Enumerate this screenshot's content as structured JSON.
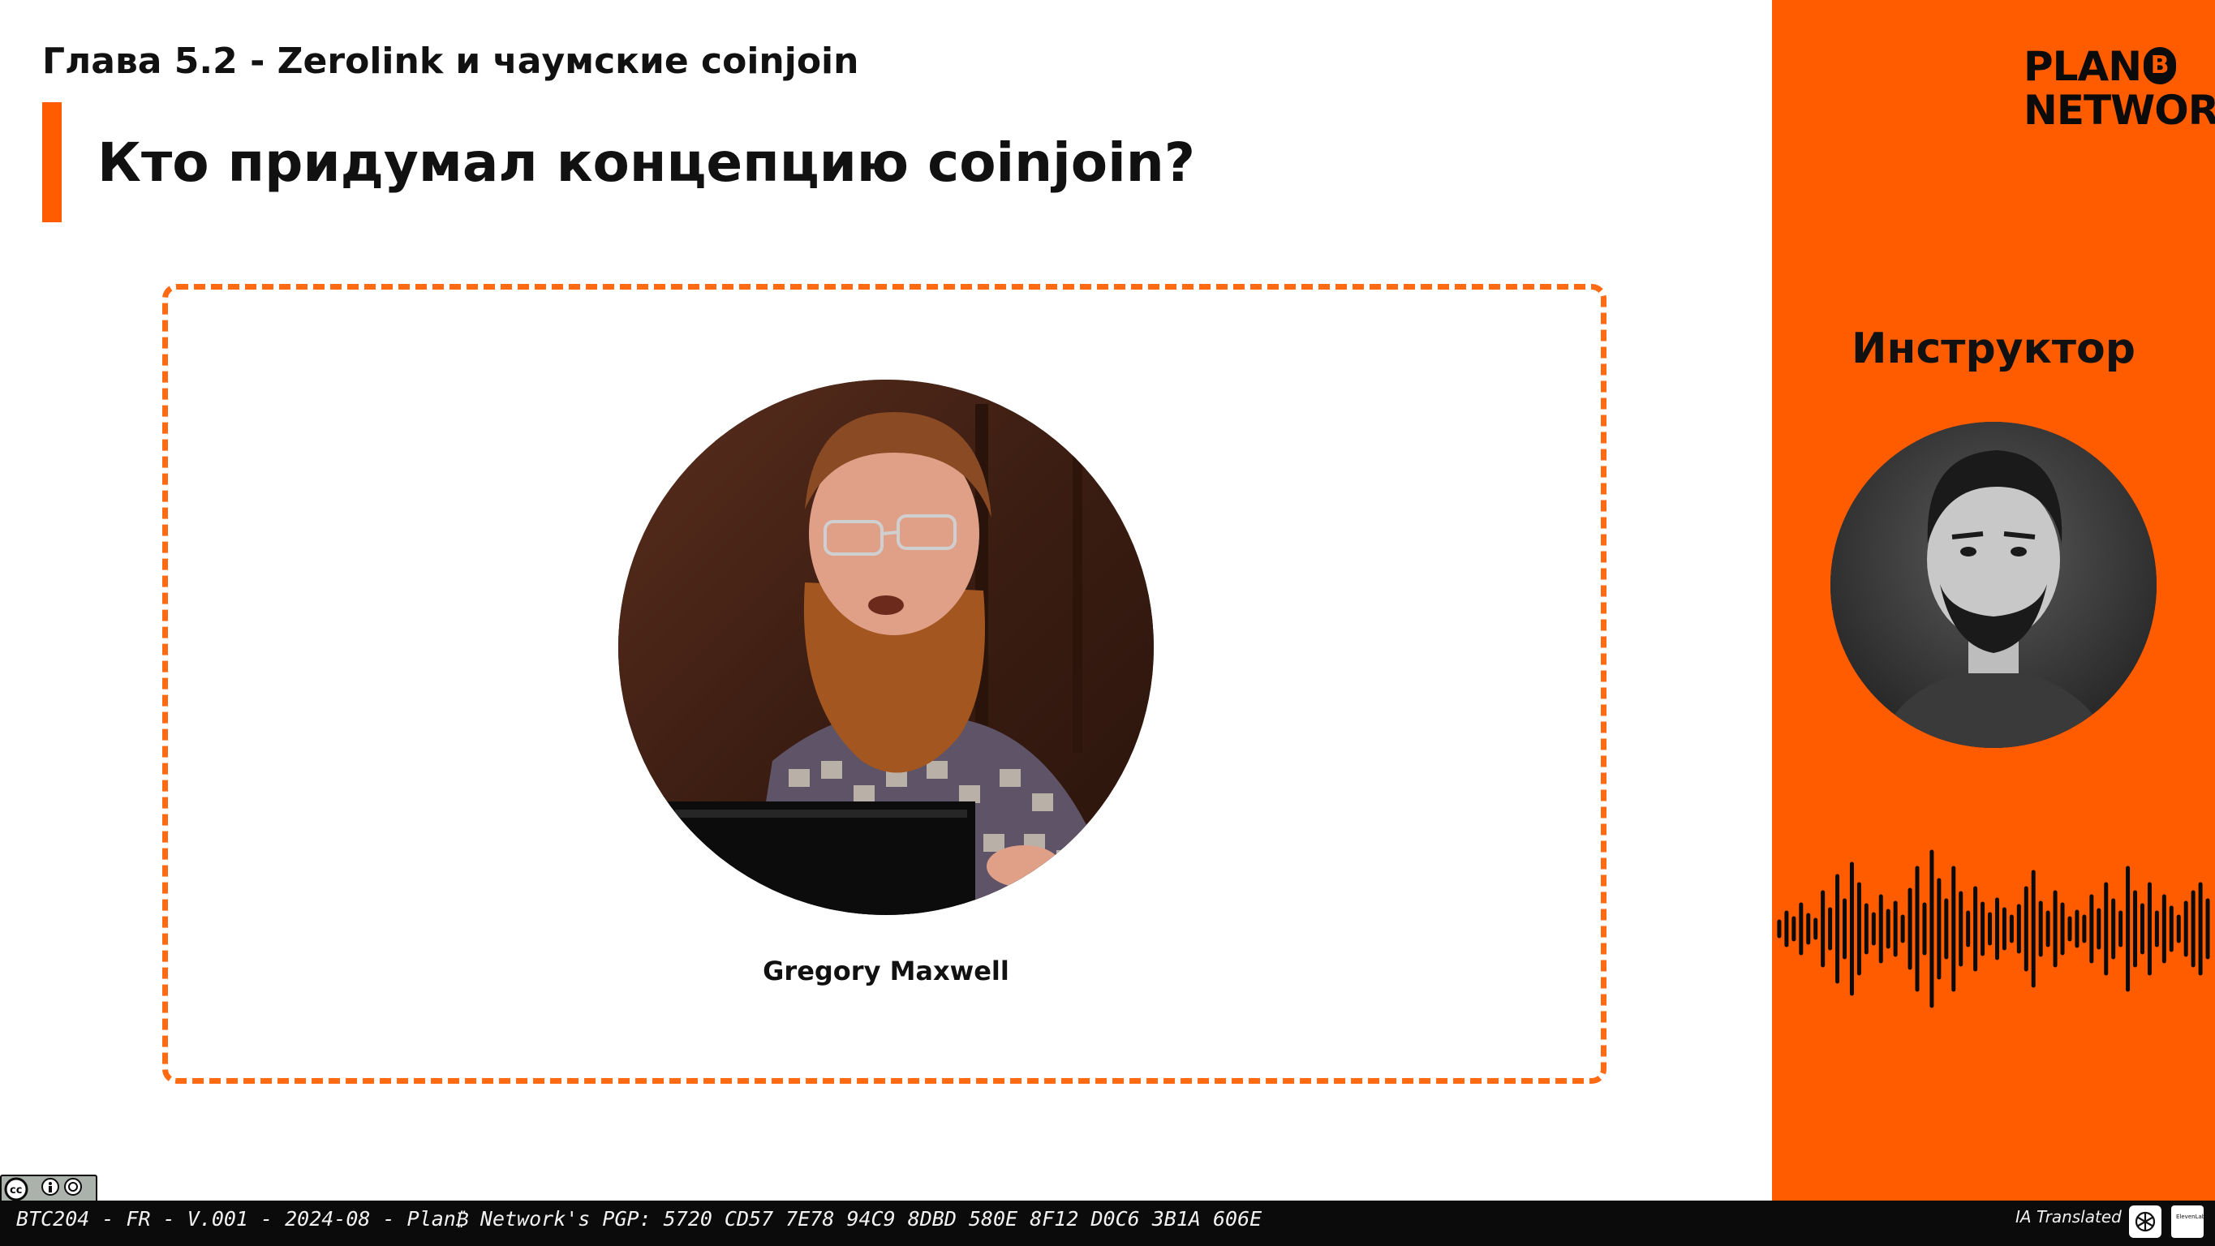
{
  "slide": {
    "chapter": "Глава 5.2 - Zerolink и чаумские coinjoin",
    "title": "Кто придумал концепцию coinjoin?"
  },
  "content": {
    "photo_caption": "Gregory Maxwell"
  },
  "sidebar": {
    "logo_line1": "PLAN",
    "logo_b": "B",
    "logo_line2": "NETWORK",
    "instructor_label": "Инструктор"
  },
  "footer": {
    "text": "BTC204 - FR - V.001 - 2024-08 - Plan₿ Network's PGP: 5720 CD57 7E78 94C9 8DBD 580E 8F12 D0C6 3B1A 606E",
    "ia_translated": "IA Translated",
    "cc_icons": [
      "cc-icon",
      "by-icon",
      "sa-icon"
    ],
    "eleven_text": "ElevenLabs"
  },
  "colors": {
    "accent": "#ff5c00",
    "dark": "#0b0b0b"
  }
}
